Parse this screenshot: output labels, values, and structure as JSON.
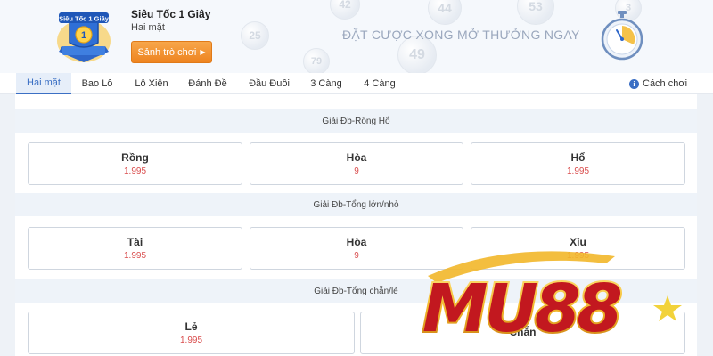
{
  "header": {
    "logo_text": "Siêu Tốc 1 Giây",
    "game_title": "Siêu Tốc 1 Giây",
    "game_subtitle": "Hai mặt",
    "lobby_button": "Sảnh trò chơi",
    "slogan": "ĐẶT CƯỢC XONG MỞ THƯỞNG NGAY",
    "ball_numbers": [
      "49",
      "44",
      "53",
      "42",
      "25",
      "79",
      "3"
    ]
  },
  "tabs": [
    "Hai mặt",
    "Bao Lô",
    "Lô Xiên",
    "Đánh Đề",
    "Đầu Đuôi",
    "3 Càng",
    "4 Càng"
  ],
  "active_tab": "Hai mặt",
  "help_label": "Cách chơi",
  "sections": [
    {
      "title": "Giải Đb-Rồng Hổ",
      "options": [
        {
          "name": "Rồng",
          "odds": "1.995"
        },
        {
          "name": "Hòa",
          "odds": "9"
        },
        {
          "name": "Hổ",
          "odds": "1.995"
        }
      ]
    },
    {
      "title": "Giải Đb-Tổng lớn/nhỏ",
      "options": [
        {
          "name": "Tài",
          "odds": "1.995"
        },
        {
          "name": "Hòa",
          "odds": "9"
        },
        {
          "name": "Xỉu",
          "odds": "1.995"
        }
      ]
    },
    {
      "title": "Giải Đb-Tổng chẵn/lẻ",
      "options": [
        {
          "name": "Lẻ",
          "odds": "1.995"
        },
        {
          "name": "Chẵn",
          "odds": ""
        }
      ]
    }
  ],
  "watermark_text": "MU88",
  "colors": {
    "accent": "#3b6fc4",
    "button_orange": "#f0892a",
    "odds_red": "#d94b4b",
    "watermark_red": "#c2181f",
    "watermark_gold": "#f2b72a"
  }
}
